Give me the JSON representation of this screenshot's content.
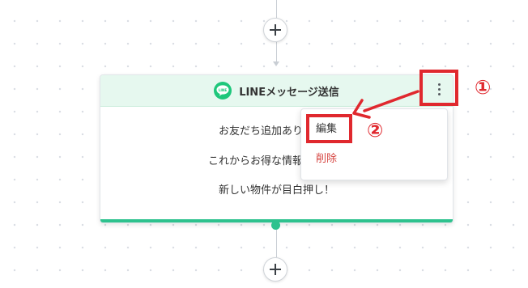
{
  "flow": {
    "add_button_symbol": "+",
    "node": {
      "title": "LINEメッセージ送信",
      "icon_text": "LINE",
      "messages": [
        "お友だち追加ありがとう",
        "これからお得な情報を毎週配",
        "新しい物件が目白押し！"
      ]
    },
    "menu": {
      "edit_label": "編集",
      "delete_label": "削除"
    }
  },
  "annotations": {
    "step1": "①",
    "step2": "②"
  },
  "colors": {
    "accent_green": "#2ec28e",
    "line_green": "#1ec77b",
    "header_bg": "#e6f8ef",
    "annotation_red": "#e0282e",
    "delete_red": "#d64541"
  }
}
